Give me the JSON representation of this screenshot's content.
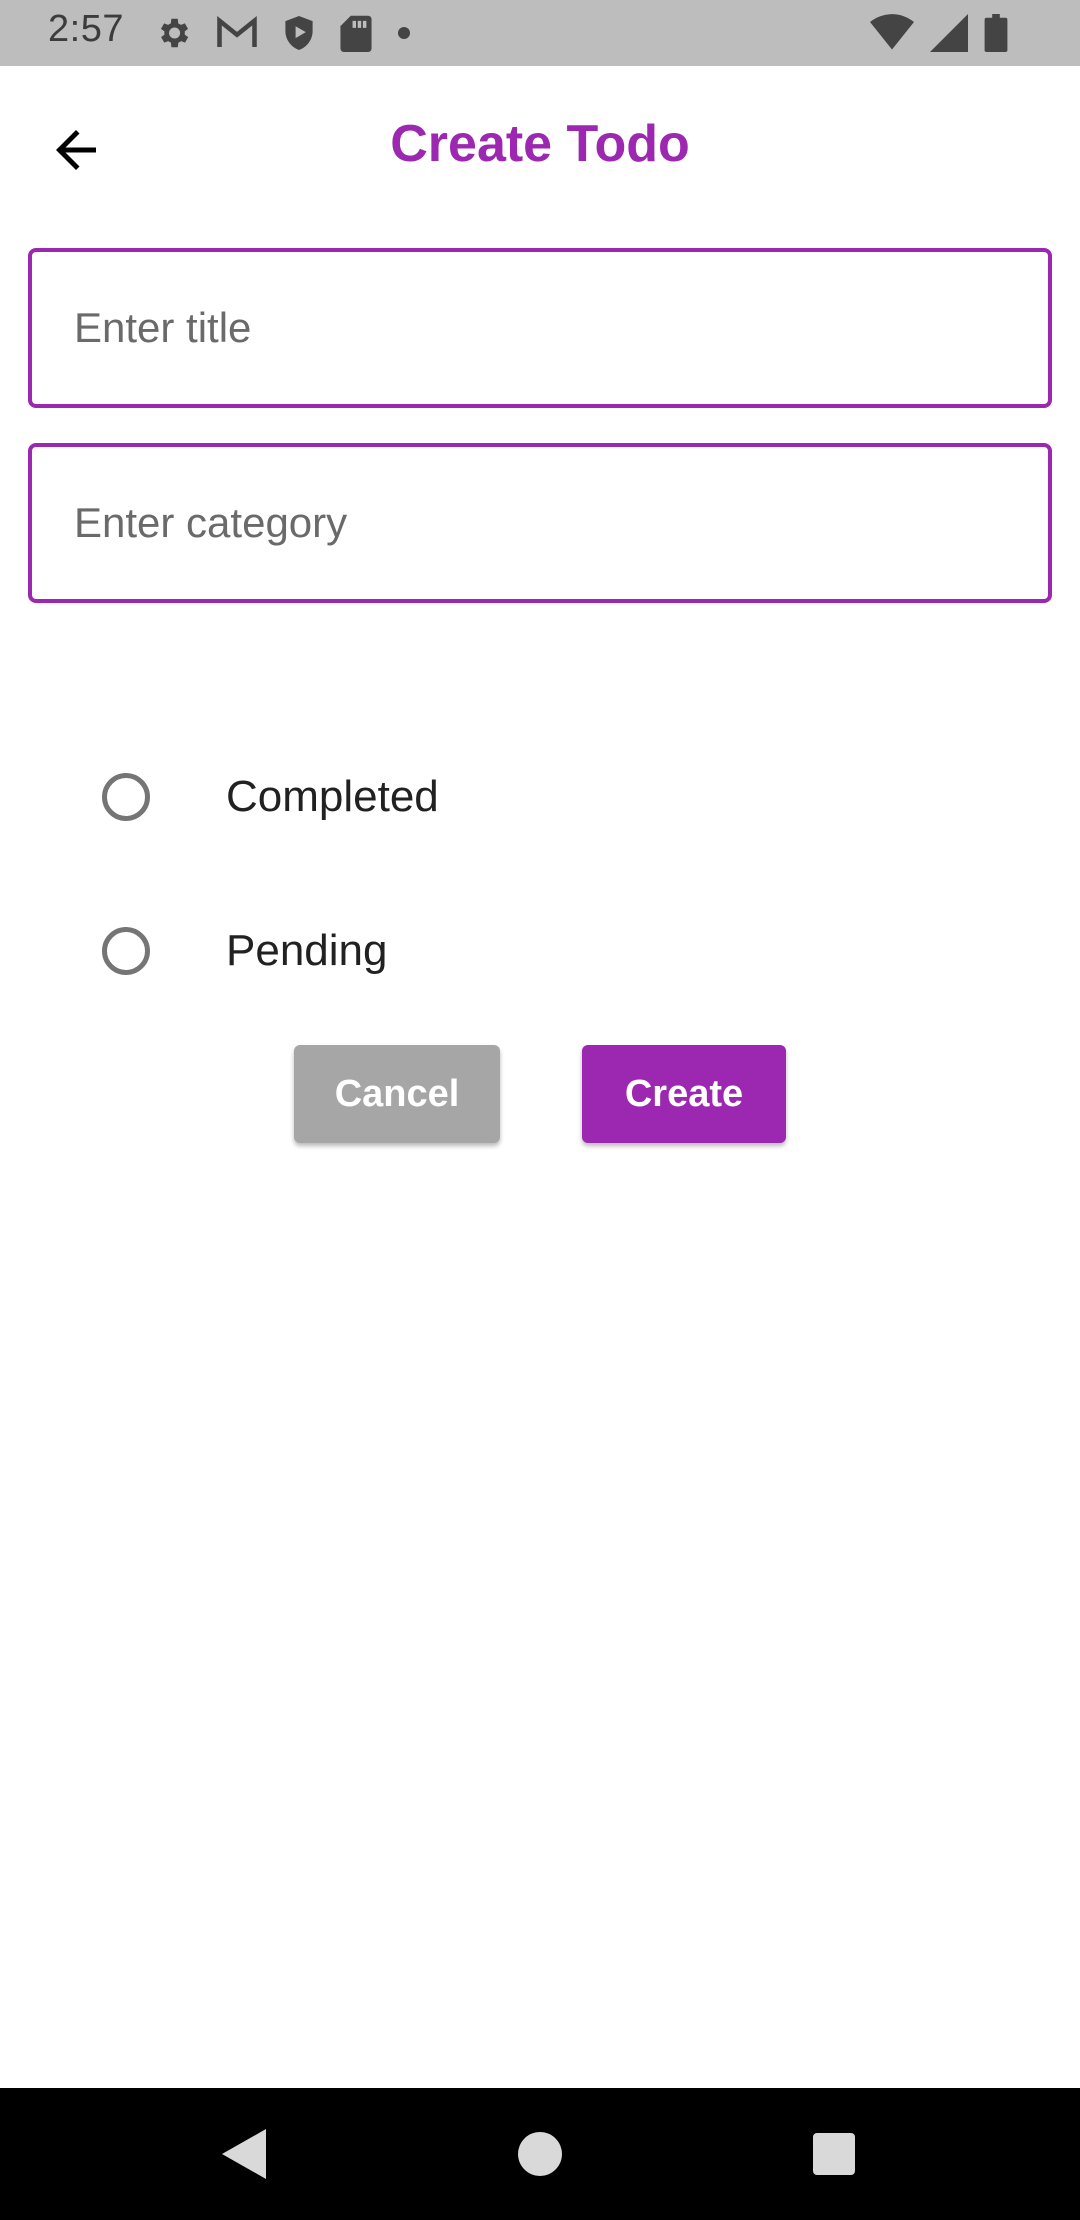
{
  "status_bar": {
    "time": "2:57",
    "left_icons": [
      "settings-icon",
      "gmail-icon",
      "shield-icon",
      "sd-card-icon",
      "dot-icon"
    ],
    "right_icons": [
      "wifi-icon",
      "cell-signal-icon",
      "battery-icon"
    ]
  },
  "app_bar": {
    "title": "Create Todo",
    "back_icon": "arrow-back-icon"
  },
  "form": {
    "title_field": {
      "value": "",
      "placeholder": "Enter title"
    },
    "category_field": {
      "value": "",
      "placeholder": "Enter category"
    },
    "status_options": [
      {
        "label": "Completed",
        "selected": false
      },
      {
        "label": "Pending",
        "selected": false
      }
    ]
  },
  "actions": {
    "cancel_label": "Cancel",
    "create_label": "Create"
  },
  "colors": {
    "accent": "#9c27b0",
    "cancel_button": "#a6a6a6",
    "status_bar": "#bdbdbd",
    "nav_bar": "#000000"
  },
  "nav_bar": {
    "buttons": [
      "back-triangle-icon",
      "home-circle-icon",
      "recents-square-icon"
    ]
  }
}
